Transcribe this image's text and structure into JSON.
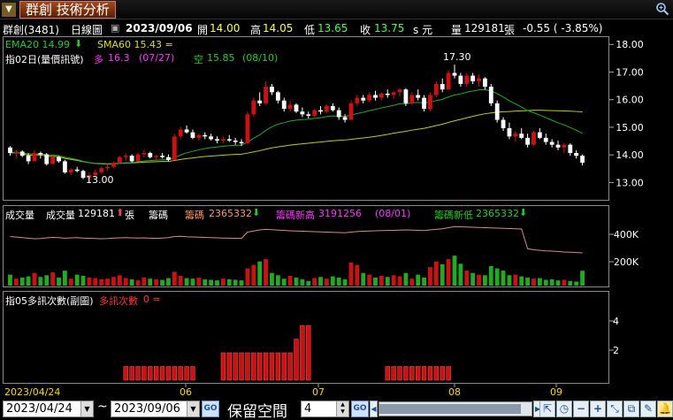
{
  "title": {
    "menu_arrow": "▼",
    "app_title": "群創 技術分析"
  },
  "info": {
    "stock": "群創(3481)",
    "period": "日線圖",
    "checkbox": "▣",
    "date": "2023/09/06",
    "open_label": "開",
    "open_value": "14.00",
    "high_label": "高",
    "high_value": "14.05",
    "low_label": "低",
    "low_value": "13.65",
    "close_label": "收",
    "close_value": "13.75",
    "unit": "s 元",
    "vol_label": "量",
    "vol_value": "129181",
    "vol_unit": "張",
    "change": "-0.55 ( -3.85%)"
  },
  "price_panel": {
    "ema20": "EMA20 14.99",
    "sma60": "SMA60 15.43 =",
    "ind_label": "指02日(量價訊號)",
    "long_label": "多",
    "long_value": "16.3",
    "long_date": "(07/27)",
    "short_label": "空",
    "short_value": "15.85",
    "short_date": "(08/10)",
    "high_mark": "17.30",
    "low_mark": "13.00",
    "y_ticks": [
      "18.00",
      "17.00",
      "16.00",
      "15.00",
      "14.00",
      "13.00"
    ]
  },
  "volume_panel": {
    "vol_title": "成交量",
    "vol_label": "成交量",
    "vol_value": "129181",
    "vol_unit": "張",
    "chip_label": "籌碼",
    "chip2_label": "籌碼",
    "chip2_value": "2365332",
    "chip_high_label": "籌碼新高",
    "chip_high_value": "3191256",
    "chip_high_date": "(08/01)",
    "chip_low_label": "籌碼新低",
    "chip_low_value": "2365332",
    "y_ticks": [
      "400K",
      "200K"
    ]
  },
  "signal_panel": {
    "ind_label": "指05多訊次數(副圖)",
    "series_label": "多訊次數",
    "series_value": "0 =",
    "y_ticks": [
      "4",
      "2"
    ]
  },
  "x_axis": {
    "start_date": "2023/04/24",
    "months": [
      "06",
      "07",
      "08",
      "09"
    ]
  },
  "toolbar": {
    "start_date": "2023/04/24",
    "tilde": "~",
    "end_date": "2023/09/06",
    "go": "GO",
    "reserve_label": "保留空間",
    "reserve_value": "4",
    "go2": "GO"
  },
  "colors": {
    "up": "#cc1111",
    "down": "#22aa22",
    "ema20": "#22aa22",
    "sma60": "#c8c820",
    "chip_line": "#d38d8d",
    "magenta": "#ff33ff",
    "axis_text": "#ffffff"
  },
  "chart_data": {
    "type": "candlestick",
    "title": "群創 技術分析",
    "x_start": "2023/04/24",
    "x_end": "2023/09/06",
    "months": [
      "06",
      "07",
      "08",
      "09"
    ],
    "ylim": [
      12.5,
      18.2
    ],
    "price_ticks": [
      18,
      17,
      16,
      15,
      14,
      13
    ],
    "candles_ohlc": [
      [
        14.3,
        14.35,
        14.0,
        14.1
      ],
      [
        14.1,
        14.2,
        13.9,
        14.15
      ],
      [
        14.15,
        14.2,
        13.95,
        14.0
      ],
      [
        14.0,
        14.1,
        13.7,
        13.8
      ],
      [
        13.8,
        14.2,
        13.8,
        14.1
      ],
      [
        14.1,
        14.15,
        13.9,
        14.05
      ],
      [
        14.05,
        14.1,
        13.65,
        13.7
      ],
      [
        13.7,
        14.0,
        13.7,
        13.95
      ],
      [
        13.95,
        14.0,
        13.75,
        13.8
      ],
      [
        13.8,
        13.85,
        13.35,
        13.4
      ],
      [
        13.4,
        13.55,
        13.3,
        13.5
      ],
      [
        13.5,
        13.6,
        13.4,
        13.45
      ],
      [
        13.45,
        13.5,
        13.15,
        13.2
      ],
      [
        13.2,
        13.4,
        13.0,
        13.3
      ],
      [
        13.3,
        13.5,
        13.25,
        13.4
      ],
      [
        13.4,
        13.6,
        13.35,
        13.55
      ],
      [
        13.55,
        13.7,
        13.45,
        13.6
      ],
      [
        13.6,
        13.8,
        13.55,
        13.75
      ],
      [
        13.75,
        14.0,
        13.7,
        13.95
      ],
      [
        13.95,
        14.1,
        13.8,
        14.0
      ],
      [
        14.0,
        14.05,
        13.75,
        13.8
      ],
      [
        13.8,
        14.1,
        13.8,
        14.05
      ],
      [
        14.05,
        14.2,
        13.95,
        14.1
      ],
      [
        14.1,
        14.15,
        13.9,
        13.95
      ],
      [
        13.95,
        14.05,
        13.85,
        14.0
      ],
      [
        14.0,
        14.1,
        13.9,
        13.95
      ],
      [
        13.95,
        14.05,
        13.8,
        13.85
      ],
      [
        13.85,
        14.8,
        13.85,
        14.7
      ],
      [
        14.7,
        15.05,
        14.6,
        14.95
      ],
      [
        14.95,
        15.1,
        14.8,
        14.85
      ],
      [
        14.85,
        14.95,
        14.6,
        14.65
      ],
      [
        14.65,
        14.8,
        14.55,
        14.75
      ],
      [
        14.75,
        14.85,
        14.6,
        14.7
      ],
      [
        14.7,
        14.8,
        14.55,
        14.6
      ],
      [
        14.6,
        14.7,
        14.45,
        14.55
      ],
      [
        14.55,
        14.7,
        14.45,
        14.6
      ],
      [
        14.6,
        14.75,
        14.5,
        14.55
      ],
      [
        14.55,
        14.65,
        14.4,
        14.5
      ],
      [
        14.5,
        14.6,
        14.35,
        14.45
      ],
      [
        14.45,
        15.6,
        14.4,
        15.5
      ],
      [
        15.5,
        16.1,
        15.4,
        16.0
      ],
      [
        16.0,
        16.3,
        15.8,
        15.9
      ],
      [
        15.9,
        16.7,
        15.85,
        16.5
      ],
      [
        16.5,
        16.6,
        16.2,
        16.3
      ],
      [
        16.3,
        16.35,
        15.9,
        16.0
      ],
      [
        16.0,
        16.1,
        15.6,
        15.7
      ],
      [
        15.7,
        16.0,
        15.6,
        15.85
      ],
      [
        15.85,
        15.9,
        15.55,
        15.6
      ],
      [
        15.6,
        15.75,
        15.4,
        15.5
      ],
      [
        15.5,
        15.6,
        15.35,
        15.45
      ],
      [
        15.45,
        15.7,
        15.4,
        15.65
      ],
      [
        15.65,
        15.8,
        15.5,
        15.6
      ],
      [
        15.6,
        15.85,
        15.55,
        15.8
      ],
      [
        15.8,
        15.9,
        15.6,
        15.65
      ],
      [
        15.65,
        15.75,
        15.3,
        15.4
      ],
      [
        15.4,
        15.5,
        15.2,
        15.3
      ],
      [
        15.3,
        16.0,
        15.3,
        15.9
      ],
      [
        15.9,
        16.2,
        15.8,
        16.1
      ],
      [
        16.1,
        16.2,
        15.9,
        16.0
      ],
      [
        16.0,
        16.3,
        15.95,
        16.2
      ],
      [
        16.2,
        16.35,
        16.0,
        16.1
      ],
      [
        16.1,
        16.3,
        16.0,
        16.25
      ],
      [
        16.25,
        16.4,
        16.1,
        16.2
      ],
      [
        16.2,
        16.35,
        16.05,
        16.3
      ],
      [
        16.3,
        16.45,
        16.15,
        16.4
      ],
      [
        16.4,
        16.45,
        15.8,
        15.9
      ],
      [
        15.9,
        16.3,
        15.85,
        16.2
      ],
      [
        16.2,
        16.4,
        16.0,
        16.1
      ],
      [
        16.1,
        16.2,
        15.6,
        15.7
      ],
      [
        15.7,
        16.3,
        15.6,
        16.2
      ],
      [
        16.2,
        16.7,
        16.1,
        16.6
      ],
      [
        16.6,
        16.8,
        16.3,
        16.4
      ],
      [
        16.4,
        17.1,
        16.4,
        17.0
      ],
      [
        17.0,
        17.3,
        16.8,
        16.9
      ],
      [
        16.9,
        17.0,
        16.5,
        16.6
      ],
      [
        16.6,
        17.0,
        16.5,
        16.9
      ],
      [
        16.9,
        17.0,
        16.6,
        16.7
      ],
      [
        16.7,
        16.95,
        16.5,
        16.8
      ],
      [
        16.8,
        16.85,
        16.4,
        16.5
      ],
      [
        16.5,
        16.6,
        15.8,
        15.9
      ],
      [
        15.9,
        16.0,
        15.2,
        15.3
      ],
      [
        15.3,
        15.4,
        14.9,
        15.0
      ],
      [
        15.0,
        15.2,
        14.6,
        14.7
      ],
      [
        14.7,
        14.9,
        14.5,
        14.8
      ],
      [
        14.8,
        15.0,
        14.6,
        14.65
      ],
      [
        14.65,
        14.8,
        14.3,
        14.4
      ],
      [
        14.4,
        14.9,
        14.35,
        14.85
      ],
      [
        14.85,
        15.0,
        14.6,
        14.65
      ],
      [
        14.65,
        14.8,
        14.4,
        14.5
      ],
      [
        14.5,
        14.6,
        14.3,
        14.4
      ],
      [
        14.4,
        14.55,
        14.2,
        14.3
      ],
      [
        14.3,
        14.45,
        14.1,
        14.4
      ],
      [
        14.4,
        14.45,
        14.0,
        14.1
      ],
      [
        14.1,
        14.2,
        13.9,
        14.0
      ],
      [
        14.0,
        14.05,
        13.65,
        13.75
      ]
    ],
    "volume_k": [
      95,
      60,
      70,
      80,
      110,
      75,
      90,
      115,
      70,
      130,
      60,
      95,
      85,
      70,
      65,
      55,
      60,
      75,
      90,
      65,
      55,
      45,
      70,
      60,
      55,
      50,
      65,
      120,
      85,
      65,
      60,
      70,
      55,
      50,
      45,
      60,
      55,
      50,
      45,
      150,
      180,
      210,
      230,
      110,
      90,
      60,
      85,
      70,
      55,
      40,
      65,
      75,
      60,
      80,
      70,
      55,
      200,
      180,
      110,
      95,
      70,
      85,
      75,
      90,
      80,
      110,
      60,
      95,
      70,
      160,
      210,
      185,
      230,
      260,
      190,
      130,
      110,
      95,
      90,
      170,
      150,
      130,
      90,
      95,
      80,
      70,
      60,
      65,
      50,
      55,
      45,
      50,
      40,
      35,
      129
    ],
    "chip_level_k": [
      380,
      375,
      370,
      365,
      360,
      362,
      368,
      372,
      370,
      365,
      368,
      370,
      366,
      364,
      362,
      360,
      362,
      366,
      368,
      370,
      368,
      366,
      368,
      365,
      363,
      366,
      370,
      380,
      382,
      378,
      376,
      374,
      372,
      370,
      368,
      366,
      365,
      364,
      363,
      420,
      430,
      440,
      445,
      442,
      438,
      435,
      432,
      430,
      428,
      426,
      424,
      422,
      420,
      418,
      416,
      414,
      420,
      425,
      428,
      430,
      432,
      434,
      435,
      436,
      438,
      440,
      438,
      436,
      434,
      440,
      445,
      450,
      460,
      470,
      468,
      466,
      464,
      462,
      460,
      458,
      456,
      454,
      452,
      450,
      448,
      270,
      260,
      255,
      250,
      248,
      245,
      240,
      238,
      235,
      232
    ]
  }
}
